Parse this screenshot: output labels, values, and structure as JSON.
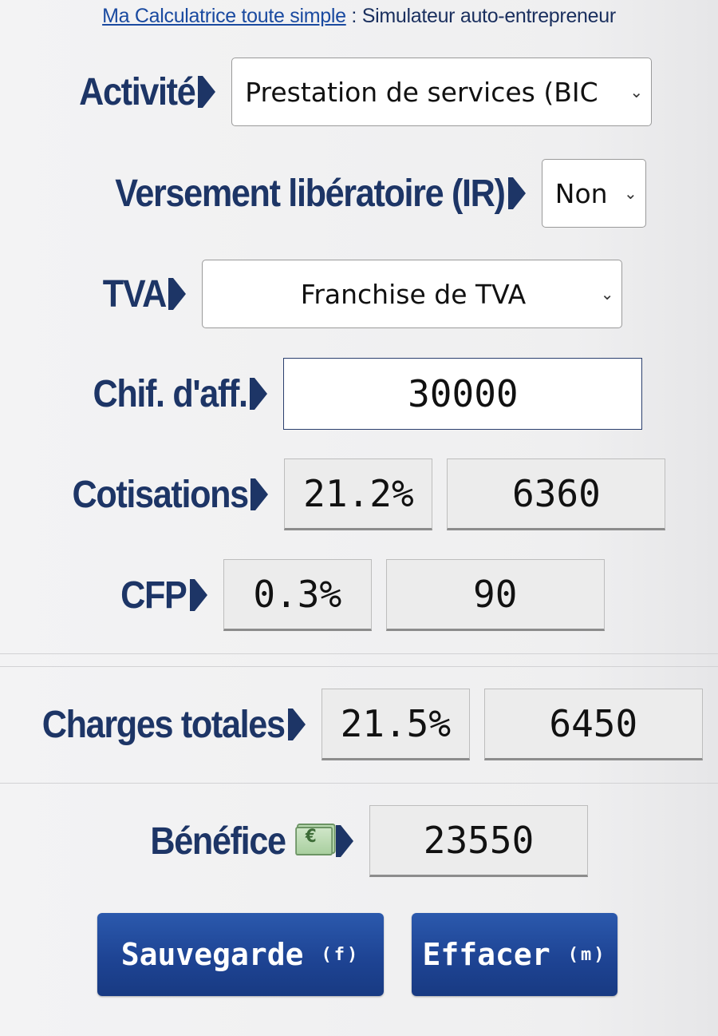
{
  "header": {
    "link_text": "Ma Calculatrice toute simple",
    "separator": ":",
    "subtitle": "Simulateur auto-entrepreneur"
  },
  "activite": {
    "label": "Activité",
    "value": "Prestation de services (BIC"
  },
  "versement": {
    "label": "Versement libératoire (IR)",
    "value": "Non"
  },
  "tva": {
    "label": "TVA",
    "value": "Franchise de TVA"
  },
  "ca": {
    "label": "Chif. d'aff.",
    "value": "30000"
  },
  "cotisations": {
    "label": "Cotisations",
    "rate": "21.2%",
    "amount": "6360"
  },
  "cfp": {
    "label": "CFP",
    "rate": "0.3%",
    "amount": "90"
  },
  "charges": {
    "label": "Charges totales",
    "rate": "21.5%",
    "amount": "6450"
  },
  "benefice": {
    "label": "Bénéfice",
    "icon": "euro-banknote-icon",
    "amount": "23550"
  },
  "buttons": {
    "save_label": "Sauvegarde",
    "save_shortcut": "(f)",
    "clear_label": "Effacer",
    "clear_shortcut": "(m)"
  },
  "colors": {
    "label": "#1d3566",
    "button": "#1e4494",
    "link": "#1a4aa0"
  }
}
